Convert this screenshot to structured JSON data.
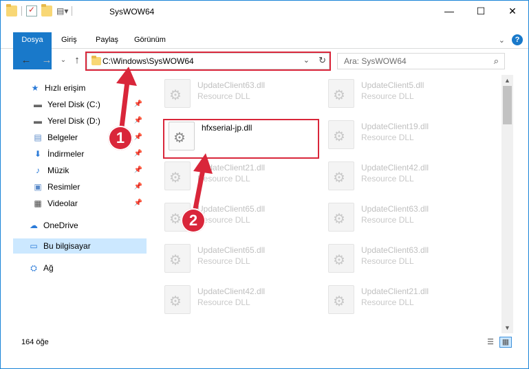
{
  "window": {
    "title": "SysWOW64",
    "controls": {
      "minimize": "—",
      "maximize": "☐",
      "close": "✕"
    }
  },
  "ribbon": {
    "tabs": [
      "Dosya",
      "Giriş",
      "Paylaş",
      "Görünüm"
    ]
  },
  "address": {
    "path": "C:\\Windows\\SysWOW64",
    "search_placeholder": "Ara: SysWOW64"
  },
  "navpane": {
    "items": [
      {
        "label": "Hızlı erişim",
        "icon": "star-icon",
        "pinned": false
      },
      {
        "label": "Yerel Disk (C:)",
        "icon": "drive-icon",
        "pinned": true
      },
      {
        "label": "Yerel Disk (D:)",
        "icon": "drive-icon",
        "pinned": true
      },
      {
        "label": "Belgeler",
        "icon": "document-icon",
        "pinned": true
      },
      {
        "label": "İndirmeler",
        "icon": "download-icon",
        "pinned": true
      },
      {
        "label": "Müzik",
        "icon": "music-icon",
        "pinned": true
      },
      {
        "label": "Resimler",
        "icon": "pictures-icon",
        "pinned": true
      },
      {
        "label": "Videolar",
        "icon": "video-icon",
        "pinned": true
      },
      {
        "label": "OneDrive",
        "icon": "cloud-icon",
        "pinned": false
      },
      {
        "label": "Bu bilgisayar",
        "icon": "computer-icon",
        "pinned": false,
        "selected": true
      },
      {
        "label": "Ağ",
        "icon": "network-icon",
        "pinned": false
      }
    ]
  },
  "files": [
    {
      "name": "UpdateClient63.dll",
      "type": "Resource DLL"
    },
    {
      "name": "UpdateClient5.dll",
      "type": "Resource DLL"
    },
    {
      "name": "hfxserial-jp.dll",
      "type": "",
      "active": true
    },
    {
      "name": "UpdateClient19.dll",
      "type": "Resource DLL"
    },
    {
      "name": "UpdateClient21.dll",
      "type": "Resource DLL"
    },
    {
      "name": "UpdateClient42.dll",
      "type": "Resource DLL"
    },
    {
      "name": "UpdateClient65.dll",
      "type": "Resource DLL"
    },
    {
      "name": "UpdateClient63.dll",
      "type": "Resource DLL"
    },
    {
      "name": "UpdateClient65.dll",
      "type": "Resource DLL"
    },
    {
      "name": "UpdateClient63.dll",
      "type": "Resource DLL"
    },
    {
      "name": "UpdateClient42.dll",
      "type": "Resource DLL"
    },
    {
      "name": "UpdateClient21.dll",
      "type": "Resource DLL"
    }
  ],
  "status": {
    "count": "164 öğe"
  },
  "annotations": {
    "marker1": "1",
    "marker2": "2",
    "color": "#d9263a"
  }
}
